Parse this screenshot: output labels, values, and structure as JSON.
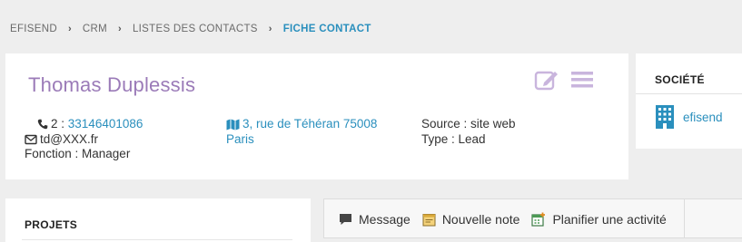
{
  "breadcrumb": {
    "items": [
      "EFISEND",
      "CRM",
      "LISTES DES CONTACTS"
    ],
    "current": "FICHE CONTACT"
  },
  "contact": {
    "name": "Thomas Duplessis",
    "phone_prefix": "2 :",
    "phone": "33146401086",
    "email": "td@XXX.fr",
    "function": "Fonction : Manager",
    "address_line1": "3, rue de Téhéran 75008",
    "address_line2": "Paris",
    "source": "Source : site web",
    "type": "Type : Lead"
  },
  "company": {
    "title": "SOCIÉTÉ",
    "name": "efisend"
  },
  "projects": {
    "title": "PROJETS"
  },
  "actions": {
    "message": "Message",
    "note": "Nouvelle note",
    "schedule": "Planifier une activité"
  },
  "icons": {
    "edit": "edit-icon",
    "menu": "hamburger-menu-icon",
    "phone": "phone-icon",
    "email": "envelope-icon",
    "address": "map-icon",
    "company": "building-icon",
    "message": "comment-icon",
    "note": "sticky-note-icon",
    "schedule": "calendar-plus-icon"
  },
  "colors": {
    "link": "#2a8fbd",
    "name": "#9b7bb8",
    "tool_icons": "#c9b5dd"
  }
}
